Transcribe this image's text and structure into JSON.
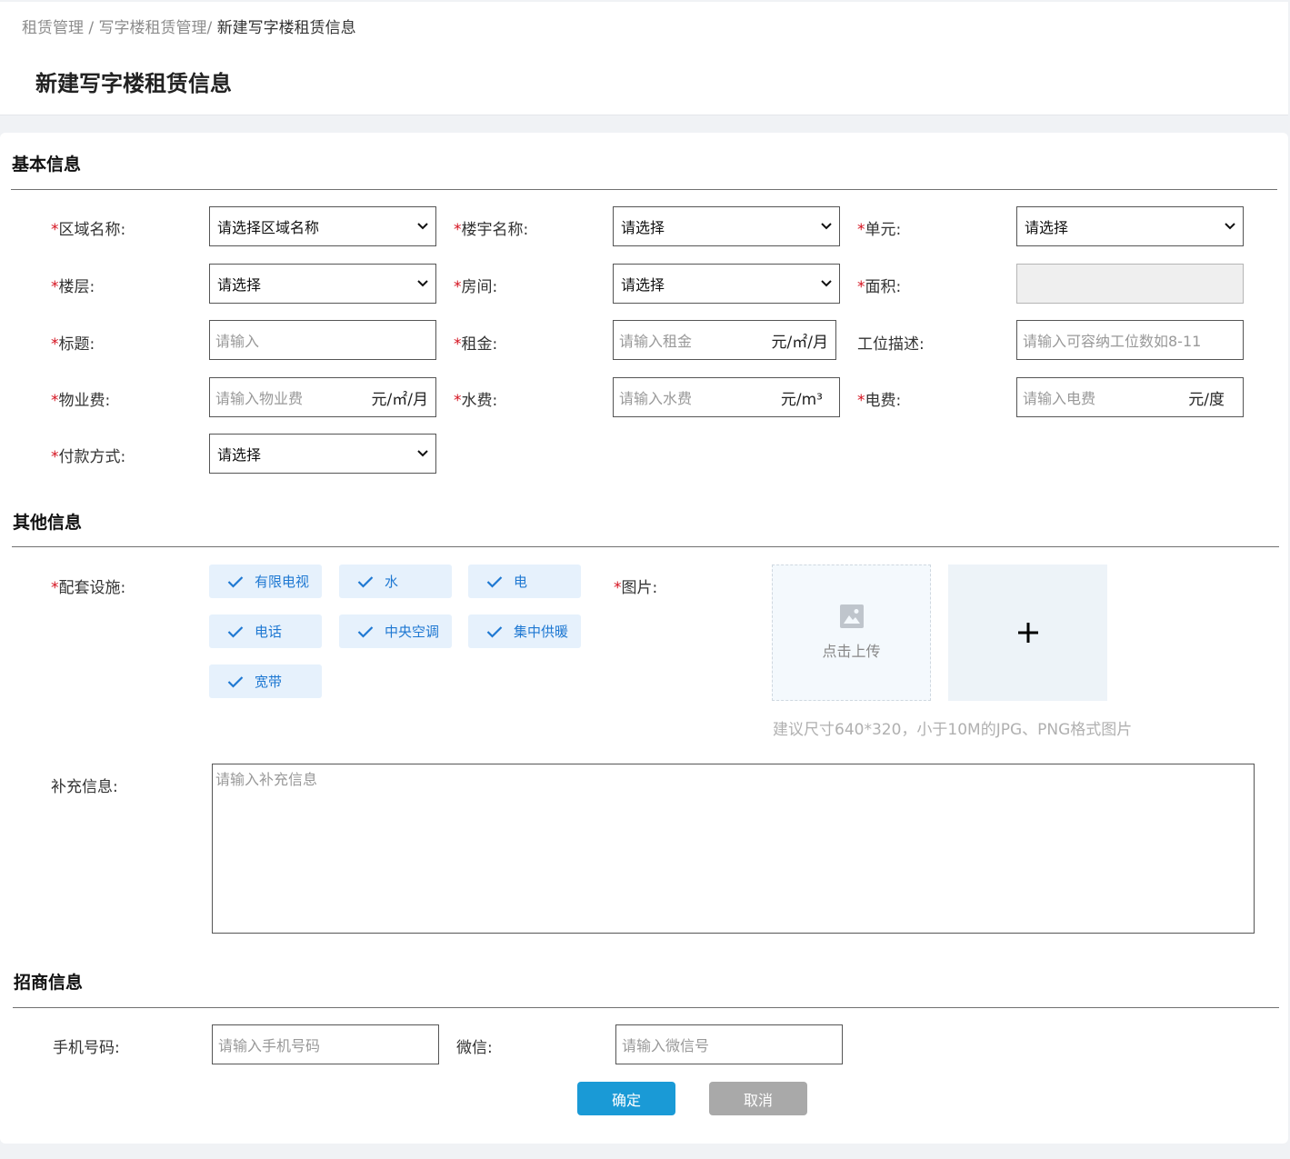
{
  "breadcrumb": {
    "item1": "租赁管理",
    "sep1": " / ",
    "item2": "写字楼租赁管理",
    "sep2": "/ ",
    "current": "新建写字楼租赁信息"
  },
  "page_title": "新建写字楼租赁信息",
  "required_mark": "*",
  "basic": {
    "title": "基本信息",
    "area_label": "区域名称:",
    "area_value": "请选择区域名称",
    "building_label": "楼宇名称:",
    "building_value": "请选择",
    "unit_label": "单元:",
    "unit_value": "请选择",
    "floor_label": "楼层:",
    "floor_value": "请选择",
    "room_label": "房间:",
    "room_value": "请选择",
    "size_label": "面积:",
    "size_value": "",
    "title_label": "标题:",
    "title_placeholder": "请输入",
    "rent_label": "租金:",
    "rent_placeholder": "请输入租金",
    "rent_unit": "元/㎡/月",
    "workstation_label": "工位描述:",
    "workstation_placeholder": "请输入可容纳工位数如8-11",
    "property_fee_label": "物业费:",
    "property_fee_placeholder": "请输入物业费",
    "property_fee_unit": "元/㎡/月",
    "water_label": "水费:",
    "water_placeholder": "请输入水费",
    "water_unit": "元/m³",
    "electric_label": "电费:",
    "electric_placeholder": "请输入电费",
    "electric_unit": "元/度",
    "payment_label": "付款方式:",
    "payment_value": "请选择"
  },
  "other": {
    "title": "其他信息",
    "facilities_label": "配套设施:",
    "facilities": [
      "有限电视",
      "水",
      "电",
      "电话",
      "中央空调",
      "集中供暖",
      "宽带"
    ],
    "image_label": "图片:",
    "upload_label": "点击上传",
    "upload_hint": "建议尺寸640*320，小于10M的JPG、PNG格式图片",
    "extra_label": "补充信息:",
    "extra_placeholder": "请输入补充信息"
  },
  "invest": {
    "title": "招商信息",
    "phone_label": "手机号码:",
    "phone_placeholder": "请输入手机号码",
    "wechat_label": "微信:",
    "wechat_placeholder": "请输入微信号"
  },
  "actions": {
    "confirm": "确定",
    "cancel": "取消"
  },
  "colors": {
    "accent": "#1a9ad6",
    "chip_bg": "#e6f1fc",
    "chip_text": "#1e78d2",
    "required": "#d4111e",
    "cancel_bg": "#a9a9a9"
  }
}
